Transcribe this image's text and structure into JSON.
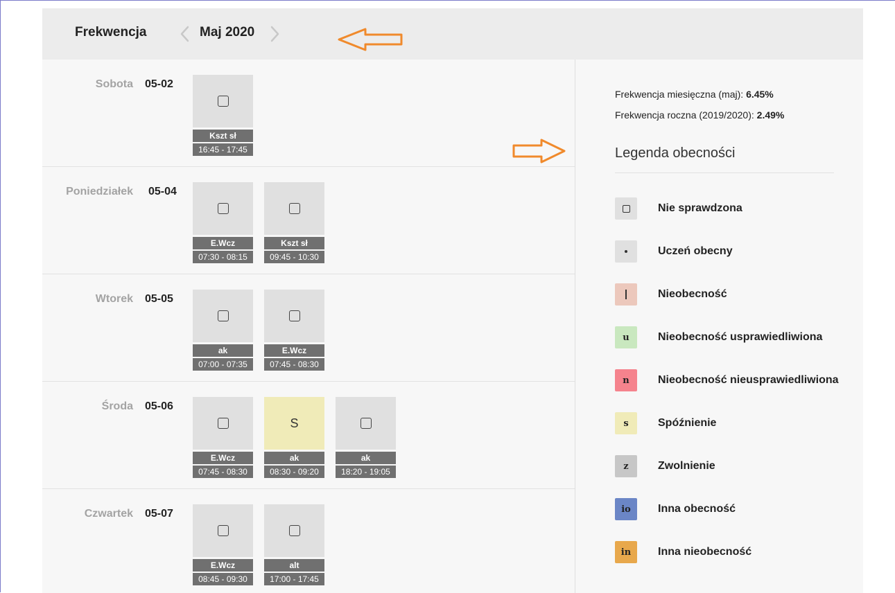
{
  "header": {
    "title": "Frekwencja",
    "month": "Maj 2020"
  },
  "days": [
    {
      "name": "Sobota",
      "date": "05-02",
      "lessons": [
        {
          "status": "not-checked",
          "subject": "Kszt sł",
          "time": "16:45 - 17:45"
        }
      ]
    },
    {
      "name": "Poniedziałek",
      "date": "05-04",
      "lessons": [
        {
          "status": "not-checked",
          "subject": "E.Wcz",
          "time": "07:30 - 08:15"
        },
        {
          "status": "not-checked",
          "subject": "Kszt sł",
          "time": "09:45 - 10:30"
        }
      ]
    },
    {
      "name": "Wtorek",
      "date": "05-05",
      "lessons": [
        {
          "status": "not-checked",
          "subject": "ak",
          "time": "07:00 - 07:35"
        },
        {
          "status": "not-checked",
          "subject": "E.Wcz",
          "time": "07:45 - 08:30"
        }
      ]
    },
    {
      "name": "Środa",
      "date": "05-06",
      "lessons": [
        {
          "status": "not-checked",
          "subject": "E.Wcz",
          "time": "07:45 - 08:30"
        },
        {
          "status": "late",
          "symbol": "S",
          "subject": "ak",
          "time": "08:30 - 09:20"
        },
        {
          "status": "not-checked",
          "subject": "ak",
          "time": "18:20 - 19:05"
        }
      ]
    },
    {
      "name": "Czwartek",
      "date": "05-07",
      "lessons": [
        {
          "status": "not-checked",
          "subject": "E.Wcz",
          "time": "08:45 - 09:30"
        },
        {
          "status": "not-checked",
          "subject": "alt",
          "time": "17:00 - 17:45"
        }
      ]
    }
  ],
  "stats": {
    "monthly_label": "Frekwencja miesięczna (maj):",
    "monthly_value": "6.45%",
    "yearly_label": "Frekwencja roczna (2019/2020):",
    "yearly_value": "2.49%"
  },
  "legend": {
    "title": "Legenda obecności",
    "items": [
      {
        "key": "nie-sprawdzona",
        "symbol_type": "square",
        "symbol": "",
        "label": "Nie sprawdzona",
        "color": "#e0e0e0"
      },
      {
        "key": "uczen-obecny",
        "symbol_type": "dot",
        "symbol": "",
        "label": "Uczeń obecny",
        "color": "#e0e0e0"
      },
      {
        "key": "nieobecnosc",
        "symbol_type": "bar",
        "symbol": "",
        "label": "Nieobecność",
        "color": "#ecc8bc"
      },
      {
        "key": "nieobecnosc-usprawiedliwiona",
        "symbol_type": "text",
        "symbol": "u",
        "label": "Nieobecność usprawiedliwiona",
        "color": "#c9e8bf"
      },
      {
        "key": "nieobecnosc-nieusprawiedliwiona",
        "symbol_type": "text",
        "symbol": "n",
        "label": "Nieobecność nieusprawiedliwiona",
        "color": "#f5838d"
      },
      {
        "key": "spoznienie",
        "symbol_type": "text",
        "symbol": "s",
        "label": "Spóźnienie",
        "color": "#f0ebb8"
      },
      {
        "key": "zwolnienie",
        "symbol_type": "text",
        "symbol": "z",
        "label": "Zwolnienie",
        "color": "#c7c7c7"
      },
      {
        "key": "inna-obecnosc",
        "symbol_type": "text",
        "symbol": "io",
        "label": "Inna obecność",
        "color": "#6b86c6"
      },
      {
        "key": "inna-nieobecnosc",
        "symbol_type": "text",
        "symbol": "in",
        "label": "Inna nieobecność",
        "color": "#e8a84c"
      }
    ]
  },
  "colors": {
    "annotation_arrow": "#f08a2c",
    "lesson_bg": "#e0e0e0",
    "lesson_late_bg": "#f0ebb8",
    "tag_bg": "#707070"
  }
}
